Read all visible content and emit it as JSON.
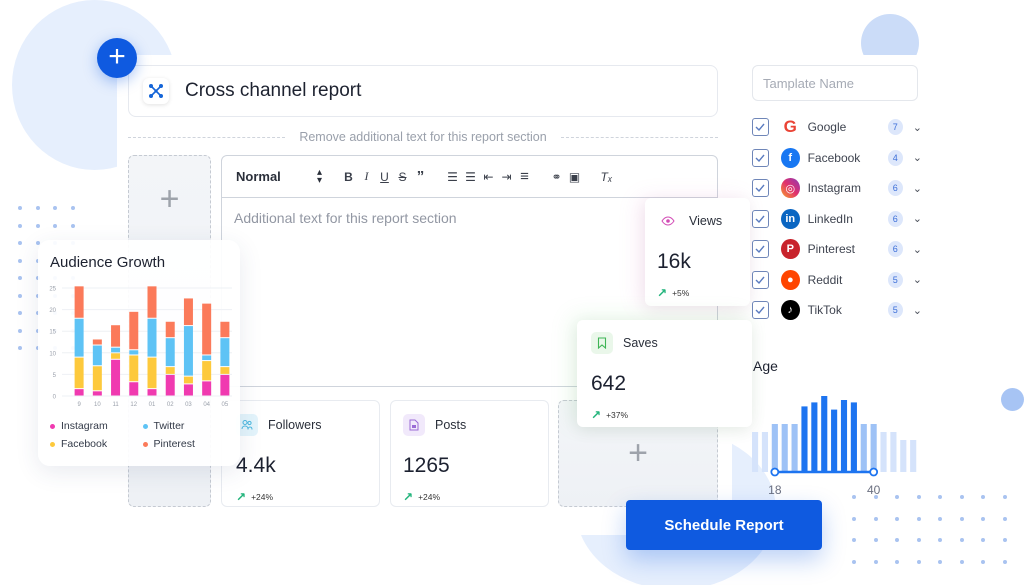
{
  "header": {
    "title": "Cross channel report",
    "add_button_icon": "plus-icon",
    "title_icon": "network-nodes-icon"
  },
  "section_divider": {
    "label": "Remove additional text for this report section"
  },
  "editor": {
    "style_select": "Normal",
    "toolbar_buttons": [
      {
        "name": "bold",
        "glyph": "B"
      },
      {
        "name": "italic",
        "glyph": "I"
      },
      {
        "name": "underline",
        "glyph": "U"
      },
      {
        "name": "strikethrough",
        "glyph": "S"
      },
      {
        "name": "blockquote",
        "glyph": "”"
      },
      {
        "name": "ordered-list",
        "glyph": "☰"
      },
      {
        "name": "bullet-list",
        "glyph": "☰"
      },
      {
        "name": "outdent",
        "glyph": "⇤"
      },
      {
        "name": "indent",
        "glyph": "⇥"
      },
      {
        "name": "align",
        "glyph": "≡"
      },
      {
        "name": "link",
        "glyph": "⚭"
      },
      {
        "name": "image",
        "glyph": "▣"
      },
      {
        "name": "clear-format",
        "glyph": "Tₓ"
      }
    ],
    "placeholder": "Additional text for this report section"
  },
  "metrics": {
    "views": {
      "label": "Views",
      "value": "16k",
      "change": "+5%"
    },
    "saves": {
      "label": "Saves",
      "value": "642",
      "change": "+37%"
    },
    "followers": {
      "label": "Followers",
      "value": "4.4k",
      "change": "+24%"
    },
    "posts": {
      "label": "Posts",
      "value": "1265",
      "change": "+24%"
    }
  },
  "template_name": {
    "placeholder": "Tamplate Name"
  },
  "channels": [
    {
      "name": "Google",
      "count": "7",
      "checked": true,
      "color": "#4285f4"
    },
    {
      "name": "Facebook",
      "count": "4",
      "checked": true,
      "color": "#1877f2"
    },
    {
      "name": "Instagram",
      "count": "6",
      "checked": true,
      "color": "#d6297a"
    },
    {
      "name": "LinkedIn",
      "count": "6",
      "checked": true,
      "color": "#0a66c2"
    },
    {
      "name": "Pinterest",
      "count": "6",
      "checked": true,
      "color": "#c8232c"
    },
    {
      "name": "Reddit",
      "count": "5",
      "checked": true,
      "color": "#ff4500"
    },
    {
      "name": "TikTok",
      "count": "5",
      "checked": true,
      "color": "#000000"
    }
  ],
  "age_filter": {
    "label": "Age",
    "range_min_label": "18",
    "range_max_label": "40",
    "histogram": [
      0.5,
      0.5,
      0.6,
      0.6,
      0.6,
      0.82,
      0.87,
      0.95,
      0.78,
      0.9,
      0.87,
      0.6,
      0.6,
      0.5,
      0.5,
      0.4,
      0.4
    ],
    "selected_range_bins": [
      2,
      12
    ]
  },
  "schedule_button": {
    "label": "Schedule Report"
  },
  "chart_data": {
    "type": "bar",
    "stacked": true,
    "title": "Audience Growth",
    "categories": [
      "9",
      "10",
      "11",
      "12",
      "01",
      "02",
      "03",
      "04",
      "05"
    ],
    "series": [
      {
        "name": "Instagram",
        "color": "#f03ab0",
        "values": [
          1.7,
          1.2,
          8.5,
          3.3,
          1.7,
          5.0,
          2.8,
          3.5,
          5.0
        ]
      },
      {
        "name": "Facebook",
        "color": "#fdc93c",
        "values": [
          7.3,
          5.8,
          1.5,
          6.2,
          7.3,
          1.8,
          1.8,
          4.7,
          1.8
        ]
      },
      {
        "name": "Twitter",
        "color": "#5ec3f5",
        "values": [
          9.0,
          4.8,
          1.3,
          1.2,
          9.0,
          6.7,
          11.7,
          1.3,
          6.7
        ]
      },
      {
        "name": "Pinterest",
        "color": "#fb7a5a",
        "values": [
          7.5,
          1.4,
          5.2,
          8.9,
          7.5,
          3.8,
          6.4,
          12.0,
          3.8
        ]
      }
    ],
    "yticks": [
      0,
      5,
      10,
      15,
      20,
      25
    ],
    "ylim": [
      0,
      25
    ],
    "xlabel": "",
    "ylabel": "",
    "grid": true,
    "legend_placement": "bottom"
  }
}
